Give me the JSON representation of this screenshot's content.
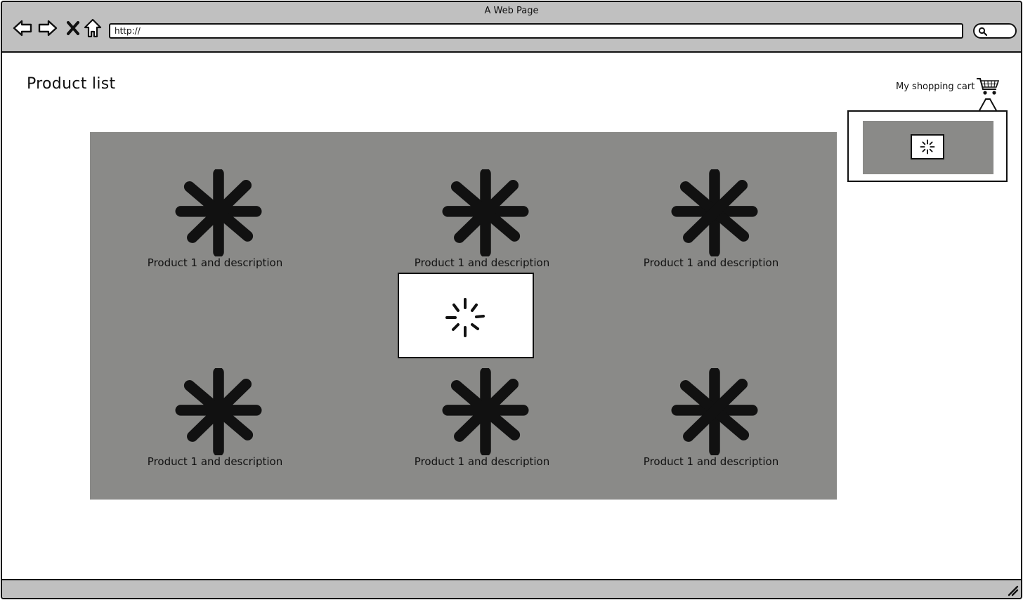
{
  "window": {
    "title": "A Web Page"
  },
  "toolbar": {
    "url": "http://",
    "icons": [
      "back-arrow-icon",
      "forward-arrow-icon",
      "close-x-icon",
      "home-icon",
      "search-icon"
    ]
  },
  "page": {
    "title": "Product list",
    "cart_label": "My shopping cart",
    "cart_icon": "shopping-cart-icon"
  },
  "products": [
    {
      "label": "Product 1 and description",
      "icon": "image-placeholder-icon"
    },
    {
      "label": "Product 1 and description",
      "icon": "image-placeholder-icon"
    },
    {
      "label": "Product 1 and description",
      "icon": "image-placeholder-icon"
    },
    {
      "label": "Product 1 and description",
      "icon": "image-placeholder-icon"
    },
    {
      "label": "Product 1 and description",
      "icon": "image-placeholder-icon"
    },
    {
      "label": "Product 1 and description",
      "icon": "image-placeholder-icon"
    }
  ],
  "loading": {
    "icon": "loading-spinner-icon"
  },
  "colors": {
    "chrome": "#c0c0c0",
    "panel": "#8a8a88",
    "ink": "#111111",
    "background": "#ffffff"
  }
}
